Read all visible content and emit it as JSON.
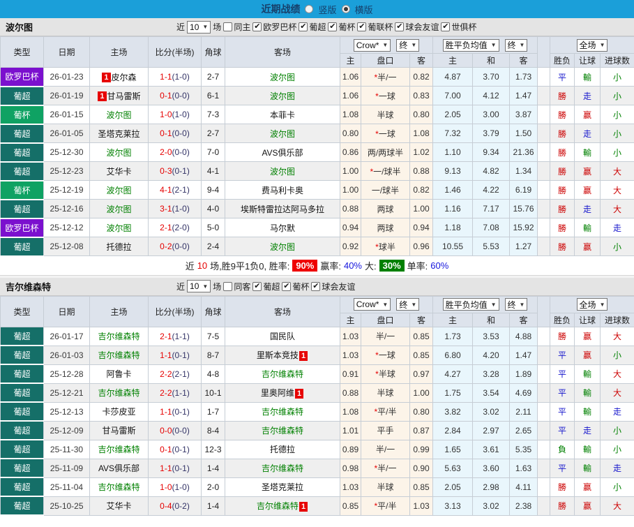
{
  "topbar": {
    "title": "近期战绩",
    "vertical_label": "竖版",
    "horizontal_label": "横版",
    "selected": "横版"
  },
  "columns": {
    "type": "类型",
    "date": "日期",
    "home": "主场",
    "score": "比分(半场)",
    "corners": "角球",
    "away": "客场",
    "odds_home": "主",
    "handicap": "盘口",
    "odds_away": "客",
    "mean_home": "主",
    "mean_draw": "和",
    "mean_away": "客",
    "result": "胜负",
    "handicap_result": "让球",
    "goals": "进球数"
  },
  "header_selects": {
    "crow": "Crow*",
    "final_a": "终",
    "wdl_mean": "胜平负均值",
    "final_b": "终",
    "full_game": "全场"
  },
  "league_colors": {
    "欧罗巴杯": "#7b10ce",
    "葡超": "#156f68",
    "葡杯": "#0fa263"
  },
  "result_colors": {
    "勝": "#cc0000",
    "赢": "#cc0000",
    "大": "#cc0000",
    "平": "#1515cc",
    "走": "#1515cc",
    "負": "#008000",
    "輸": "#008000",
    "小": "#008000"
  },
  "colors": {
    "topbar": "#1b9fd9",
    "odds_bg": "#fcf4e9",
    "mean_bg": "#e9f6fc",
    "self_team": "#008000",
    "score_ft": "#e60000",
    "badge": "#e60000"
  },
  "sections": [
    {
      "team": "波尔图",
      "filter": {
        "near": "近",
        "count": "10",
        "unit": "场",
        "same_label": "同主",
        "same_checked": false,
        "leagues": [
          "欧罗巴杯",
          "葡超",
          "葡杯",
          "葡联杯",
          "球会友谊",
          "世俱杯"
        ]
      },
      "rows": [
        {
          "league": "欧罗巴杯",
          "date": "26-01-23",
          "home": {
            "name": "皮尔森",
            "self": false,
            "badge": "1",
            "badge_pos": "before"
          },
          "ft": "1-1",
          "ht": "1-0",
          "corners": "2-7",
          "away": {
            "name": "波尔图",
            "self": true
          },
          "oh": "1.06",
          "star": true,
          "hc": "半/一",
          "oa": "0.82",
          "mh": "4.87",
          "md": "3.70",
          "ma": "1.73",
          "res": "平",
          "hres": "輸",
          "gres": "小"
        },
        {
          "league": "葡超",
          "date": "26-01-19",
          "home": {
            "name": "甘马雷斯",
            "self": false,
            "badge": "1",
            "badge_pos": "before"
          },
          "ft": "0-1",
          "ht": "0-0",
          "corners": "6-1",
          "away": {
            "name": "波尔图",
            "self": true
          },
          "oh": "1.06",
          "star": true,
          "hc": "一球",
          "oa": "0.83",
          "mh": "7.00",
          "md": "4.12",
          "ma": "1.47",
          "res": "勝",
          "hres": "走",
          "gres": "小"
        },
        {
          "league": "葡杯",
          "date": "26-01-15",
          "home": {
            "name": "波尔图",
            "self": true
          },
          "ft": "1-0",
          "ht": "1-0",
          "corners": "7-3",
          "away": {
            "name": "本菲卡",
            "self": false
          },
          "oh": "1.08",
          "star": false,
          "hc": "半球",
          "oa": "0.80",
          "mh": "2.05",
          "md": "3.00",
          "ma": "3.87",
          "res": "勝",
          "hres": "赢",
          "gres": "小"
        },
        {
          "league": "葡超",
          "date": "26-01-05",
          "home": {
            "name": "圣塔克莱拉",
            "self": false
          },
          "ft": "0-1",
          "ht": "0-0",
          "corners": "2-7",
          "away": {
            "name": "波尔图",
            "self": true
          },
          "oh": "0.80",
          "star": true,
          "hc": "一球",
          "oa": "1.08",
          "mh": "7.32",
          "md": "3.79",
          "ma": "1.50",
          "res": "勝",
          "hres": "走",
          "gres": "小"
        },
        {
          "league": "葡超",
          "date": "25-12-30",
          "home": {
            "name": "波尔图",
            "self": true
          },
          "ft": "2-0",
          "ht": "0-0",
          "corners": "7-0",
          "away": {
            "name": "AVS俱乐部",
            "self": false
          },
          "oh": "0.86",
          "star": false,
          "hc": "两/两球半",
          "oa": "1.02",
          "mh": "1.10",
          "md": "9.34",
          "ma": "21.36",
          "res": "勝",
          "hres": "輸",
          "gres": "小"
        },
        {
          "league": "葡超",
          "date": "25-12-23",
          "home": {
            "name": "艾华卡",
            "self": false
          },
          "ft": "0-3",
          "ht": "0-1",
          "corners": "4-1",
          "away": {
            "name": "波尔图",
            "self": true
          },
          "oh": "1.00",
          "star": true,
          "hc": "一/球半",
          "oa": "0.88",
          "mh": "9.13",
          "md": "4.82",
          "ma": "1.34",
          "res": "勝",
          "hres": "赢",
          "gres": "大"
        },
        {
          "league": "葡杯",
          "date": "25-12-19",
          "home": {
            "name": "波尔图",
            "self": true
          },
          "ft": "4-1",
          "ht": "2-1",
          "corners": "9-4",
          "away": {
            "name": "费马利卡奥",
            "self": false
          },
          "oh": "1.00",
          "star": false,
          "hc": "一/球半",
          "oa": "0.82",
          "mh": "1.46",
          "md": "4.22",
          "ma": "6.19",
          "res": "勝",
          "hres": "赢",
          "gres": "大"
        },
        {
          "league": "葡超",
          "date": "25-12-16",
          "home": {
            "name": "波尔图",
            "self": true
          },
          "ft": "3-1",
          "ht": "1-0",
          "corners": "4-0",
          "away": {
            "name": "埃斯特雷拉达阿马多拉",
            "self": false
          },
          "oh": "0.88",
          "star": false,
          "hc": "两球",
          "oa": "1.00",
          "mh": "1.16",
          "md": "7.17",
          "ma": "15.76",
          "res": "勝",
          "hres": "走",
          "gres": "大"
        },
        {
          "league": "欧罗巴杯",
          "date": "25-12-12",
          "home": {
            "name": "波尔图",
            "self": true
          },
          "ft": "2-1",
          "ht": "2-0",
          "corners": "5-0",
          "away": {
            "name": "马尔默",
            "self": false
          },
          "oh": "0.94",
          "star": false,
          "hc": "两球",
          "oa": "0.94",
          "mh": "1.18",
          "md": "7.08",
          "ma": "15.92",
          "res": "勝",
          "hres": "輸",
          "gres": "走"
        },
        {
          "league": "葡超",
          "date": "25-12-08",
          "home": {
            "name": "托德拉",
            "self": false
          },
          "ft": "0-2",
          "ht": "0-0",
          "corners": "2-4",
          "away": {
            "name": "波尔图",
            "self": true
          },
          "oh": "0.92",
          "star": true,
          "hc": "球半",
          "oa": "0.96",
          "mh": "10.55",
          "md": "5.53",
          "ma": "1.27",
          "res": "勝",
          "hres": "赢",
          "gres": "小"
        }
      ],
      "summary": {
        "near": "近",
        "count": "10",
        "record_text": "场,胜9平1负0, 胜率:",
        "win_pct": "90%",
        "win_rate_label": "赢率:",
        "win_rate": "40%",
        "big_label": "大:",
        "big_pct": "30%",
        "single_label": "单率:",
        "single_rate": "60%"
      }
    },
    {
      "team": "吉尔维森特",
      "filter": {
        "near": "近",
        "count": "10",
        "unit": "场",
        "same_label": "同客",
        "same_checked": false,
        "leagues": [
          "葡超",
          "葡杯",
          "球会友谊"
        ]
      },
      "rows": [
        {
          "league": "葡超",
          "date": "26-01-17",
          "home": {
            "name": "吉尔维森特",
            "self": true
          },
          "ft": "2-1",
          "ht": "1-1",
          "corners": "7-5",
          "away": {
            "name": "国民队",
            "self": false
          },
          "oh": "1.03",
          "star": false,
          "hc": "半/一",
          "oa": "0.85",
          "mh": "1.73",
          "md": "3.53",
          "ma": "4.88",
          "res": "勝",
          "hres": "赢",
          "gres": "大"
        },
        {
          "league": "葡超",
          "date": "26-01-03",
          "home": {
            "name": "吉尔维森特",
            "self": true
          },
          "ft": "1-1",
          "ht": "0-1",
          "corners": "8-7",
          "away": {
            "name": "里斯本竞技",
            "self": false,
            "badge": "1",
            "badge_pos": "after"
          },
          "oh": "1.03",
          "star": true,
          "hc": "一球",
          "oa": "0.85",
          "mh": "6.80",
          "md": "4.20",
          "ma": "1.47",
          "res": "平",
          "hres": "赢",
          "gres": "小"
        },
        {
          "league": "葡超",
          "date": "25-12-28",
          "home": {
            "name": "阿鲁卡",
            "self": false
          },
          "ft": "2-2",
          "ht": "2-1",
          "corners": "4-8",
          "away": {
            "name": "吉尔维森特",
            "self": true
          },
          "oh": "0.91",
          "star": true,
          "hc": "半球",
          "oa": "0.97",
          "mh": "4.27",
          "md": "3.28",
          "ma": "1.89",
          "res": "平",
          "hres": "輸",
          "gres": "大"
        },
        {
          "league": "葡超",
          "date": "25-12-21",
          "home": {
            "name": "吉尔维森特",
            "self": true
          },
          "ft": "2-2",
          "ht": "1-1",
          "corners": "10-1",
          "away": {
            "name": "里奥阿维",
            "self": false,
            "badge": "1",
            "badge_pos": "after"
          },
          "oh": "0.88",
          "star": false,
          "hc": "半球",
          "oa": "1.00",
          "mh": "1.75",
          "md": "3.54",
          "ma": "4.69",
          "res": "平",
          "hres": "輸",
          "gres": "大"
        },
        {
          "league": "葡超",
          "date": "25-12-13",
          "home": {
            "name": "卡莎皮亚",
            "self": false
          },
          "ft": "1-1",
          "ht": "0-1",
          "corners": "1-7",
          "away": {
            "name": "吉尔维森特",
            "self": true
          },
          "oh": "1.08",
          "star": true,
          "hc": "平/半",
          "oa": "0.80",
          "mh": "3.82",
          "md": "3.02",
          "ma": "2.11",
          "res": "平",
          "hres": "輸",
          "gres": "走"
        },
        {
          "league": "葡超",
          "date": "25-12-09",
          "home": {
            "name": "甘马雷斯",
            "self": false
          },
          "ft": "0-0",
          "ht": "0-0",
          "corners": "8-4",
          "away": {
            "name": "吉尔维森特",
            "self": true
          },
          "oh": "1.01",
          "star": false,
          "hc": "平手",
          "oa": "0.87",
          "mh": "2.84",
          "md": "2.97",
          "ma": "2.65",
          "res": "平",
          "hres": "走",
          "gres": "小"
        },
        {
          "league": "葡超",
          "date": "25-11-30",
          "home": {
            "name": "吉尔维森特",
            "self": true
          },
          "ft": "0-1",
          "ht": "0-1",
          "corners": "12-3",
          "away": {
            "name": "托德拉",
            "self": false
          },
          "oh": "0.89",
          "star": false,
          "hc": "半/一",
          "oa": "0.99",
          "mh": "1.65",
          "md": "3.61",
          "ma": "5.35",
          "res": "負",
          "hres": "輸",
          "gres": "小"
        },
        {
          "league": "葡超",
          "date": "25-11-09",
          "home": {
            "name": "AVS俱乐部",
            "self": false
          },
          "ft": "1-1",
          "ht": "0-1",
          "corners": "1-4",
          "away": {
            "name": "吉尔维森特",
            "self": true
          },
          "oh": "0.98",
          "star": true,
          "hc": "半/一",
          "oa": "0.90",
          "mh": "5.63",
          "md": "3.60",
          "ma": "1.63",
          "res": "平",
          "hres": "輸",
          "gres": "走"
        },
        {
          "league": "葡超",
          "date": "25-11-04",
          "home": {
            "name": "吉尔维森特",
            "self": true
          },
          "ft": "1-0",
          "ht": "1-0",
          "corners": "2-0",
          "away": {
            "name": "圣塔克莱拉",
            "self": false
          },
          "oh": "1.03",
          "star": false,
          "hc": "半球",
          "oa": "0.85",
          "mh": "2.05",
          "md": "2.98",
          "ma": "4.11",
          "res": "勝",
          "hres": "赢",
          "gres": "小"
        },
        {
          "league": "葡超",
          "date": "25-10-25",
          "home": {
            "name": "艾华卡",
            "self": false
          },
          "ft": "0-4",
          "ht": "0-2",
          "corners": "1-4",
          "away": {
            "name": "吉尔维森特",
            "self": true,
            "badge": "1",
            "badge_pos": "after"
          },
          "oh": "0.85",
          "star": true,
          "hc": "平/半",
          "oa": "1.03",
          "mh": "3.13",
          "md": "3.02",
          "ma": "2.38",
          "res": "勝",
          "hres": "赢",
          "gres": "大"
        }
      ]
    }
  ]
}
